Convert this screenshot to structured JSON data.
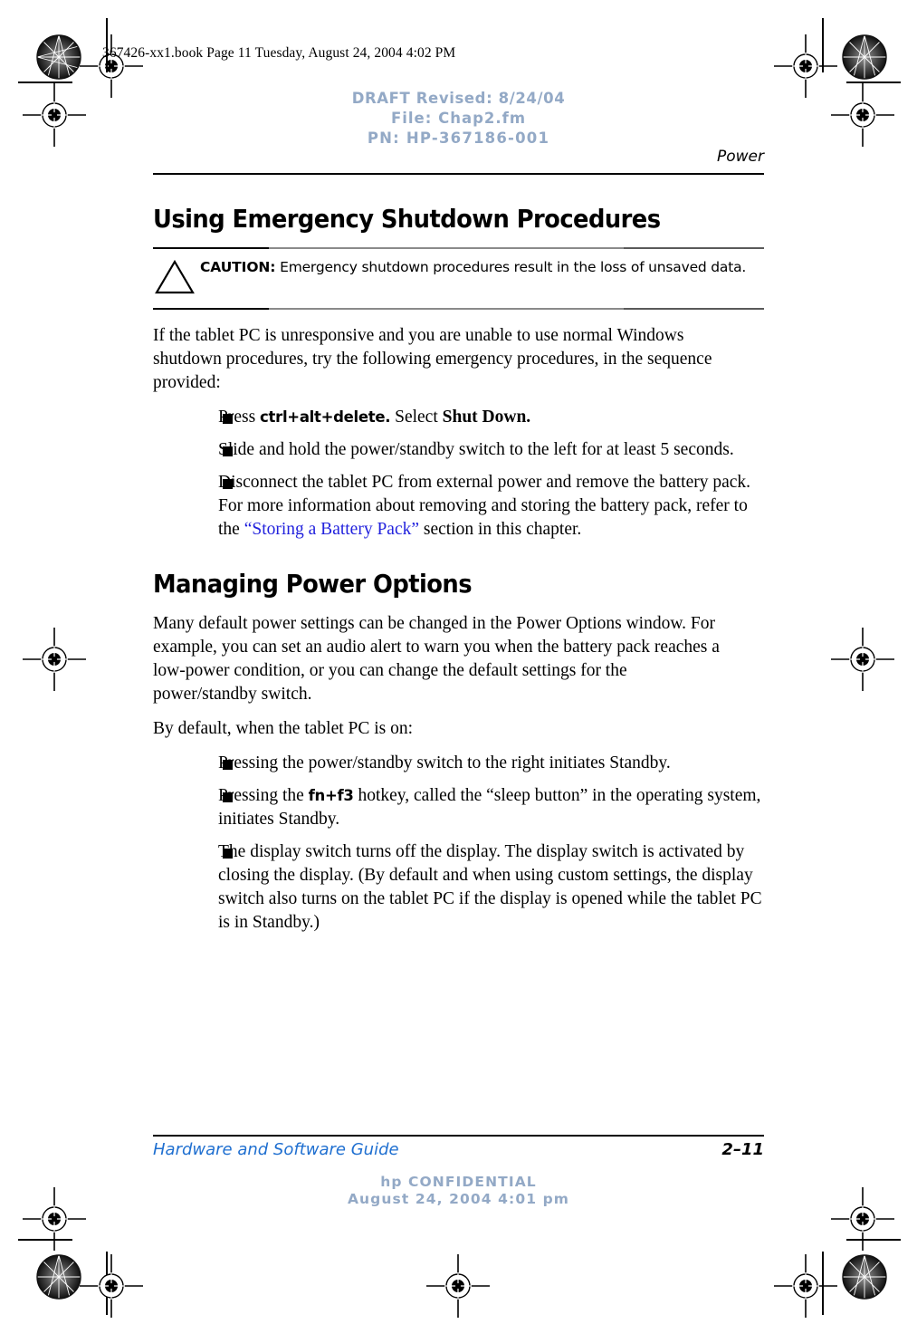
{
  "page": {
    "book_header": "367426-xx1.book  Page 11  Tuesday, August 24, 2004  4:02 PM",
    "running_head": "Power",
    "draft_stamp": {
      "line1": "DRAFT Revised: 8/24/04",
      "line2": "File: Chap2.fm",
      "line3": "PN: HP-367186-001",
      "color": "#93a9c6"
    }
  },
  "sections": [
    {
      "title": "Using Emergency Shutdown Procedures",
      "caution": {
        "label": "CAUTION:",
        "text": " Emergency shutdown procedures result in the loss of unsaved data.",
        "icon": "warning-triangle-icon"
      },
      "intro": "If the tablet PC is unresponsive and you are unable to use normal Windows shutdown procedures, try the following emergency procedures, in the sequence provided:",
      "bullets": [
        {
          "parts": [
            {
              "t": "Press ",
              "style": "plain"
            },
            {
              "t": "ctrl+alt+delete.",
              "style": "keycap"
            },
            {
              "t": " Select ",
              "style": "plain"
            },
            {
              "t": "Shut Down.",
              "style": "bold-serif"
            }
          ]
        },
        {
          "parts": [
            {
              "t": "Slide and hold the power/standby switch to the left for at least 5 seconds.",
              "style": "plain"
            }
          ]
        },
        {
          "parts": [
            {
              "t": "Disconnect the tablet PC from external power and remove the battery pack. For more information about removing and storing the battery pack, refer to the ",
              "style": "plain"
            },
            {
              "t": "“Storing a Battery Pack”",
              "style": "xref"
            },
            {
              "t": " section in this chapter.",
              "style": "plain"
            }
          ]
        }
      ]
    },
    {
      "title": "Managing Power Options",
      "paragraphs": [
        "Many default power settings can be changed in the Power Options window. For example, you can set an audio alert to warn you when the battery pack reaches a low-power condition, or you can change the default settings for the power/standby switch.",
        "By default, when the tablet PC is on:"
      ],
      "bullets": [
        {
          "parts": [
            {
              "t": "Pressing the power/standby switch to the right initiates Standby.",
              "style": "plain"
            }
          ]
        },
        {
          "parts": [
            {
              "t": "Pressing the ",
              "style": "plain"
            },
            {
              "t": "fn+f3",
              "style": "keycap"
            },
            {
              "t": " hotkey, called the “sleep button” in the operating system, initiates Standby.",
              "style": "plain"
            }
          ]
        },
        {
          "parts": [
            {
              "t": "The display switch turns off the display. The display switch is activated by closing the display. (By default and when using custom settings, the display switch also turns on the tablet PC if the display is opened while the tablet PC is in Standby.)",
              "style": "plain"
            }
          ]
        }
      ]
    }
  ],
  "footer": {
    "guide_title": "Hardware and Software Guide",
    "page_number": "2–11",
    "confidential_line1": "hp CONFIDENTIAL",
    "confidential_line2": "August 24, 2004 4:01 pm",
    "guide_color": "#1f6fd0",
    "confidential_color": "#93a9c6"
  }
}
